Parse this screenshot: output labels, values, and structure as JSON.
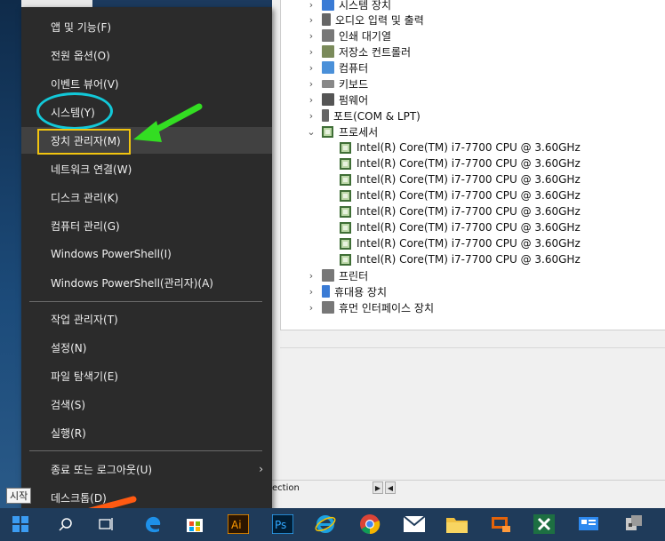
{
  "device_manager": {
    "tree_items": [
      {
        "label": "시스템 장치",
        "chev": "›",
        "icon_color": "#3a7bd5"
      },
      {
        "label": "오디오 입력 및 출력",
        "chev": "›",
        "icon_color": "#666666"
      },
      {
        "label": "인쇄 대기열",
        "chev": "›",
        "icon_color": "#777777"
      },
      {
        "label": "저장소 컨트롤러",
        "chev": "›",
        "icon_color": "#7a8a5a"
      },
      {
        "label": "컴퓨터",
        "chev": "›",
        "icon_color": "#4a90d9"
      },
      {
        "label": "키보드",
        "chev": "›",
        "icon_color": "#888888"
      },
      {
        "label": "펌웨어",
        "chev": "›",
        "icon_color": "#555555"
      },
      {
        "label": "포트(COM & LPT)",
        "chev": "›",
        "icon_color": "#666666"
      },
      {
        "label": "프로세서",
        "chev": "⌄",
        "icon_color": "#3f6e36"
      }
    ],
    "processors": [
      "Intel(R) Core(TM) i7-7700 CPU @ 3.60GHz",
      "Intel(R) Core(TM) i7-7700 CPU @ 3.60GHz",
      "Intel(R) Core(TM) i7-7700 CPU @ 3.60GHz",
      "Intel(R) Core(TM) i7-7700 CPU @ 3.60GHz",
      "Intel(R) Core(TM) i7-7700 CPU @ 3.60GHz",
      "Intel(R) Core(TM) i7-7700 CPU @ 3.60GHz",
      "Intel(R) Core(TM) i7-7700 CPU @ 3.60GHz",
      "Intel(R) Core(TM) i7-7700 CPU @ 3.60GHz"
    ],
    "tree_items_after": [
      {
        "label": "프린터",
        "chev": "›",
        "icon_color": "#777777"
      },
      {
        "label": "휴대용 장치",
        "chev": "›",
        "icon_color": "#3a7bd5"
      },
      {
        "label": "휴먼 인터페이스 장치",
        "chev": "›",
        "icon_color": "#777777"
      }
    ],
    "bottom_bar_text": "ection",
    "scroll_right": "▶",
    "scroll_left": "◀"
  },
  "winx_menu": {
    "items": [
      {
        "label": "앱 및 기능(F)"
      },
      {
        "label": "전원 옵션(O)"
      },
      {
        "label": "이벤트 뷰어(V)"
      },
      {
        "label": "시스템(Y)"
      },
      {
        "label": "장치 관리자(M)"
      },
      {
        "label": "네트워크 연결(W)"
      },
      {
        "label": "디스크 관리(K)"
      },
      {
        "label": "컴퓨터 관리(G)"
      },
      {
        "label": "Windows PowerShell(I)"
      },
      {
        "label": "Windows PowerShell(관리자)(A)"
      },
      {
        "label": "작업 관리자(T)"
      },
      {
        "label": "설정(N)"
      },
      {
        "label": "파일 탐색기(E)"
      },
      {
        "label": "검색(S)"
      },
      {
        "label": "실행(R)"
      },
      {
        "label": "종료 또는 로그아웃(U)"
      },
      {
        "label": "데스크톱(D)"
      }
    ],
    "submenu_arrow": "›"
  },
  "tooltip": "시작",
  "taskbar": {
    "icons": [
      "start-icon",
      "search-icon",
      "task-view-icon",
      "edge-icon",
      "store-icon",
      "illustrator-icon",
      "photoshop-icon",
      "ie-icon",
      "chrome-icon",
      "mail-icon",
      "folder-icon",
      "remote-icon",
      "excel-icon",
      "control-panel-icon",
      "device-icon"
    ],
    "labels": {
      "illustrator": "Ai",
      "photoshop": "Ps"
    }
  },
  "annotation_colors": {
    "circle": "#12c8d8",
    "rect": "#f1c40f",
    "green_arrow": "#33dd22",
    "orange_arrow": "#ff5a12"
  }
}
